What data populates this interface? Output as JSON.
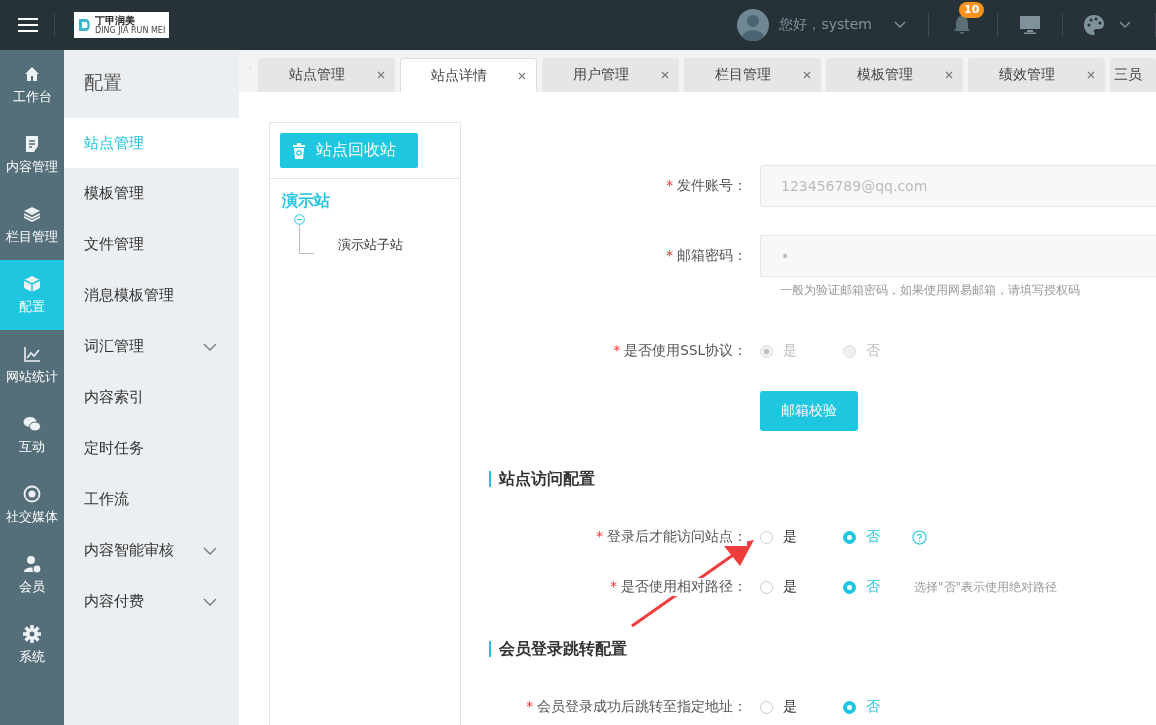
{
  "topbar": {
    "logo": {
      "name": "丁甲润美",
      "subtitle": "DING JIA RUN MEI"
    },
    "greeting": "您好，system",
    "notification_count": "10"
  },
  "rail": [
    {
      "label": "工作台",
      "selected": false
    },
    {
      "label": "内容管理",
      "selected": false
    },
    {
      "label": "栏目管理",
      "selected": false
    },
    {
      "label": "配置",
      "selected": true
    },
    {
      "label": "网站统计",
      "selected": false
    },
    {
      "label": "互动",
      "selected": false
    },
    {
      "label": "社交媒体",
      "selected": false
    },
    {
      "label": "会员",
      "selected": false
    },
    {
      "label": "系统",
      "selected": false
    }
  ],
  "submenu": {
    "title": "配置",
    "items": [
      {
        "label": "站点管理",
        "selected": true,
        "expandable": false
      },
      {
        "label": "模板管理",
        "selected": false,
        "expandable": false
      },
      {
        "label": "文件管理",
        "selected": false,
        "expandable": false
      },
      {
        "label": "消息模板管理",
        "selected": false,
        "expandable": false
      },
      {
        "label": "词汇管理",
        "selected": false,
        "expandable": true
      },
      {
        "label": "内容索引",
        "selected": false,
        "expandable": false
      },
      {
        "label": "定时任务",
        "selected": false,
        "expandable": false
      },
      {
        "label": "工作流",
        "selected": false,
        "expandable": false
      },
      {
        "label": "内容智能审核",
        "selected": false,
        "expandable": true
      },
      {
        "label": "内容付费",
        "selected": false,
        "expandable": true
      }
    ]
  },
  "tabs": [
    {
      "label": "站点管理",
      "selected": false
    },
    {
      "label": "站点详情",
      "selected": true
    },
    {
      "label": "用户管理",
      "selected": false
    },
    {
      "label": "栏目管理",
      "selected": false
    },
    {
      "label": "模板管理",
      "selected": false
    },
    {
      "label": "绩效管理",
      "selected": false
    },
    {
      "label": "三员",
      "selected": false
    }
  ],
  "tree": {
    "button": "站点回收站",
    "root": {
      "label": "演示站",
      "expanded": true,
      "children": [
        {
          "label": "演示站子站"
        }
      ]
    }
  },
  "form": [
    {
      "kind": "text",
      "required_mark": "*",
      "label": "发件账号：",
      "value": "123456789@qq.com",
      "disabled": true
    },
    {
      "kind": "text",
      "required_mark": "*",
      "label": "邮箱密码：",
      "value": "•",
      "disabled": true,
      "hint": "一般为验证邮箱密码，如果使用网易邮箱，请填写授权码"
    },
    {
      "kind": "radio",
      "required_mark": "*",
      "label": "是否使用SSL协议：",
      "disabled": true,
      "options": [
        {
          "label": "是",
          "selected": true
        },
        {
          "label": "否",
          "selected": false
        }
      ]
    },
    {
      "kind": "button",
      "label": "邮箱校验"
    },
    {
      "kind": "section",
      "title": "站点访问配置"
    },
    {
      "kind": "radio",
      "required_mark": "*",
      "label": "登录后才能访问站点：",
      "disabled": false,
      "help": true,
      "options": [
        {
          "label": "是",
          "selected": false
        },
        {
          "label": "否",
          "selected": true
        }
      ]
    },
    {
      "kind": "radio",
      "required_mark": "*",
      "label": "是否使用相对路径：",
      "disabled": false,
      "note": "选择\"否\"表示使用绝对路径",
      "options": [
        {
          "label": "是",
          "selected": false
        },
        {
          "label": "否",
          "selected": true
        }
      ]
    },
    {
      "kind": "section",
      "title": "会员登录跳转配置"
    },
    {
      "kind": "radio",
      "required_mark": "*",
      "label": "会员登录成功后跳转至指定地址：",
      "disabled": false,
      "options": [
        {
          "label": "是",
          "selected": false
        },
        {
          "label": "否",
          "selected": true
        }
      ]
    }
  ]
}
